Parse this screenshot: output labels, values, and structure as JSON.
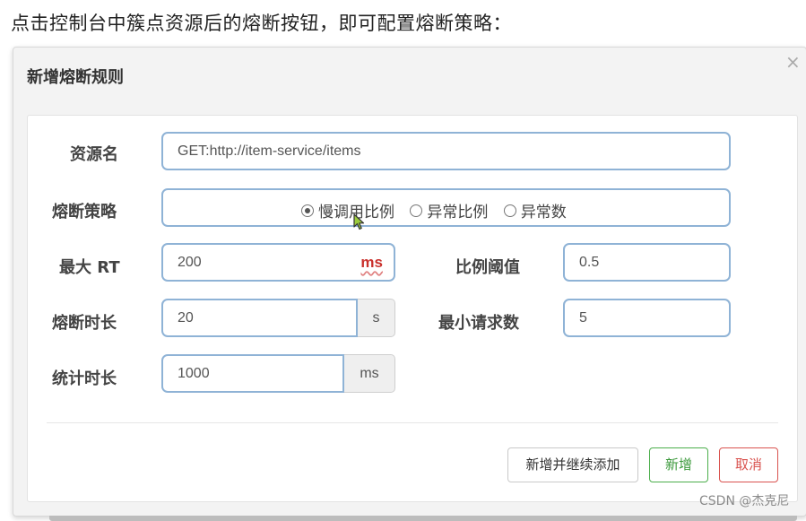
{
  "intro_text": "点击控制台中簇点资源后的熔断按钮，即可配置熔断策略：",
  "dialog": {
    "title": "新增熔断规则",
    "close_symbol": "×"
  },
  "form": {
    "resource": {
      "label": "资源名",
      "value": "GET:http://item-service/items"
    },
    "strategy": {
      "label": "熔断策略",
      "options": [
        "慢调用比例",
        "异常比例",
        "异常数"
      ],
      "selected": "慢调用比例"
    },
    "max_rt": {
      "label": "最大 RT",
      "value": "200",
      "unit": "ms"
    },
    "ratio_threshold": {
      "label": "比例阈值",
      "value": "0.5"
    },
    "break_duration": {
      "label": "熔断时长",
      "value": "20",
      "unit": "s"
    },
    "min_requests": {
      "label": "最小请求数",
      "value": "5"
    },
    "stat_duration": {
      "label": "统计时长",
      "value": "1000",
      "unit": "ms"
    }
  },
  "buttons": {
    "add_continue": "新增并继续添加",
    "add": "新增",
    "cancel": "取消"
  },
  "watermark": "CSDN @杰克尼",
  "colors": {
    "input_border": "#8fb3d6",
    "success": "#4cae4c",
    "danger": "#d9534f"
  }
}
